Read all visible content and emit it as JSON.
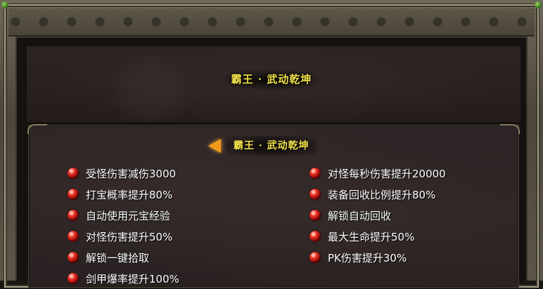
{
  "header": {
    "title": "霸王 · 武动乾坤"
  },
  "section": {
    "title": "霸王 · 武动乾坤"
  },
  "features_left": [
    "受怪伤害减伤3000",
    "打宝概率提升80%",
    "自动使用元宝经验",
    "对怪伤害提升50%",
    "解锁一键拾取",
    "剑甲爆率提升100%"
  ],
  "features_right": [
    "对怪每秒伤害提升20000",
    "装备回收比例提升80%",
    "解锁自动回收",
    "最大生命提升50%",
    "PK伤害提升30%"
  ],
  "icons": {
    "bullet": "red-orb-icon",
    "arrow": "arrow-left-icon"
  },
  "colors": {
    "title": "#f2e24a",
    "bullet": "#d8261c",
    "arrow": "#f39a1b",
    "text": "#ffffff"
  }
}
